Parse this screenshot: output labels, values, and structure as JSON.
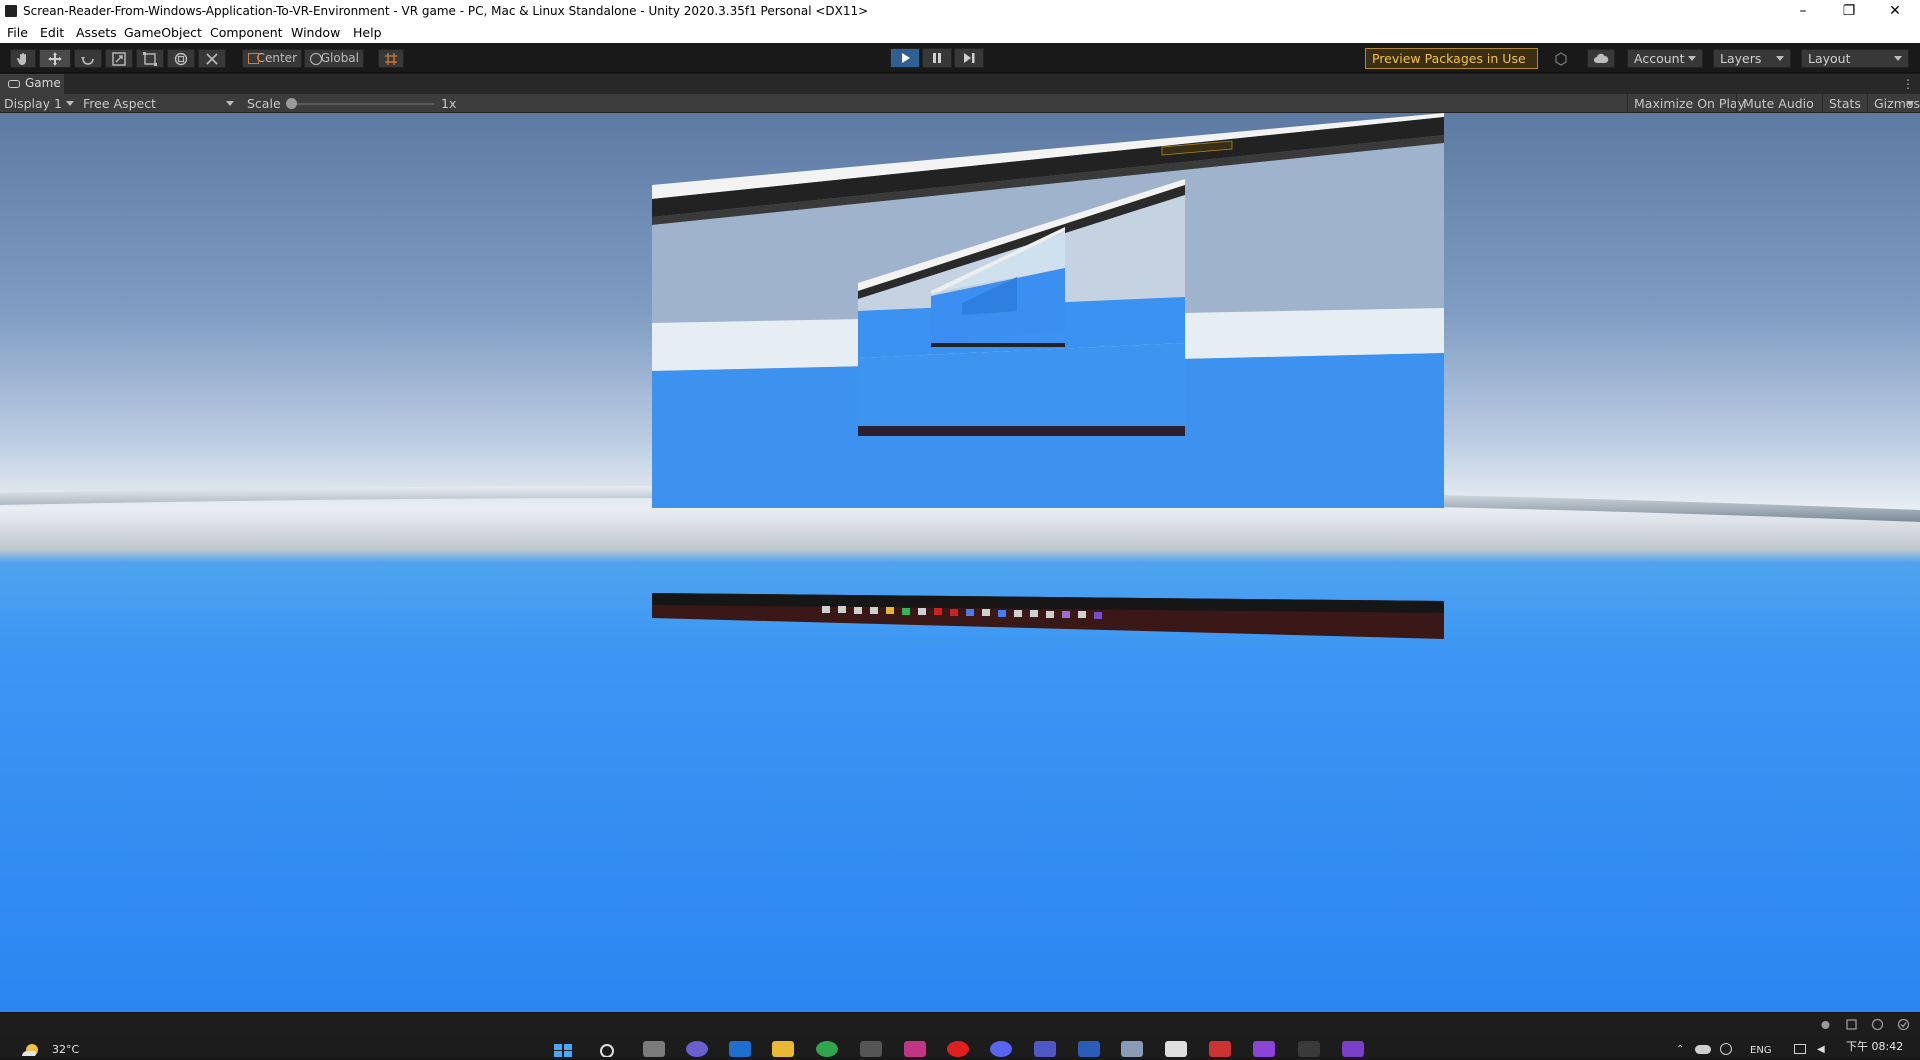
{
  "window": {
    "title": "Screan-Reader-From-Windows-Application-To-VR-Environment - VR game - PC, Mac & Linux Standalone - Unity 2020.3.35f1 Personal <DX11>",
    "minimize_icon": "minimize-icon",
    "maximize_icon": "restore-icon",
    "close_icon": "close-icon"
  },
  "menu": [
    "File",
    "Edit",
    "Assets",
    "GameObject",
    "Component",
    "Window",
    "Help"
  ],
  "toolbar": {
    "tools": [
      "hand-tool-icon",
      "move-tool-icon",
      "rotate-tool-icon",
      "scale-tool-icon",
      "rect-tool-icon",
      "transform-tool-icon",
      "custom-tool-icon"
    ],
    "pivot_label": "Center",
    "space_label": "Global",
    "play_icon": "play-icon",
    "pause_icon": "pause-icon",
    "step_icon": "step-icon",
    "preview_packages": "Preview Packages in Use",
    "account": "Account",
    "layers": "Layers",
    "layout": "Layout"
  },
  "game_view": {
    "tab_label": "Game",
    "display": "Display 1",
    "aspect": "Free Aspect",
    "scale_label": "Scale",
    "scale_value": "1x",
    "maximize_on_play": "Maximize On Play",
    "mute_audio": "Mute Audio",
    "stats": "Stats",
    "gizmos": "Gizmos"
  },
  "taskbar": {
    "weather": "32°C",
    "lang": "ENG",
    "time": "下午 08:42"
  },
  "colors": {
    "play_active": "#2f5f93",
    "preview_accent": "#f3c24a",
    "sky_top": "#5d7aa3",
    "ground": "#2b86f2"
  }
}
